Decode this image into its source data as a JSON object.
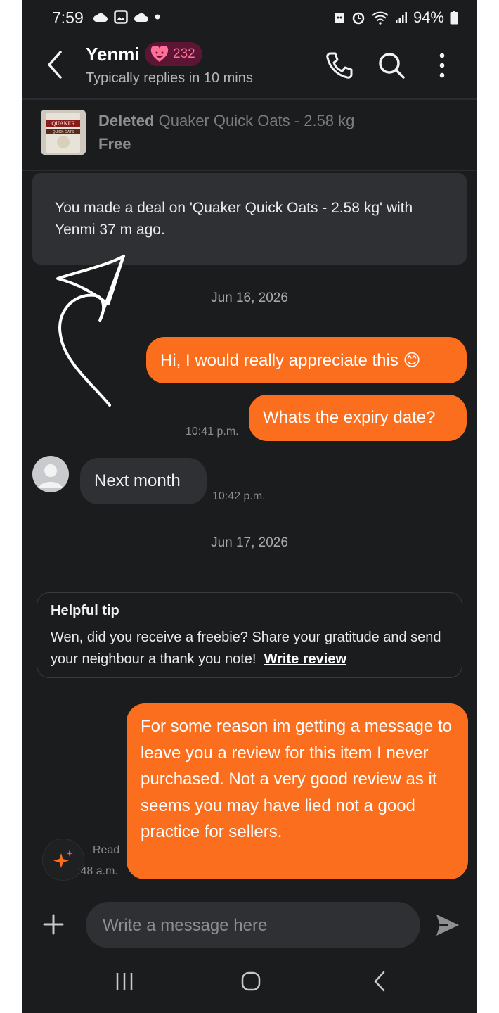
{
  "status_bar": {
    "time": "7:59",
    "battery": "94%"
  },
  "header": {
    "title": "Yenmi",
    "badge_count": "232",
    "subtitle": "Typically replies in 10 mins"
  },
  "listing": {
    "status": "Deleted",
    "name": "Quaker Quick Oats - 2.58 kg",
    "price": "Free",
    "thumb_brand": "QUAKER",
    "thumb_caption": "QUICK OATS"
  },
  "deal_notice": "You made a deal on 'Quaker Quick Oats - 2.58 kg' with Yenmi 37 m ago.",
  "messages": {
    "date1": "Jun 16, 2026",
    "msg1": "Hi, I would really appreciate this",
    "msg1_emoji": "😊",
    "msg2": "Whats the expiry date?",
    "msg2_time": "10:41 p.m.",
    "msg3": "Next month",
    "msg3_time": "10:42 p.m.",
    "date2": "Jun 17, 2026",
    "msg4": "For some reason im getting a message to leave you a review for this item I never purchased. Not a very good review as it seems you may have lied not a good practice for sellers.",
    "msg4_read": "Read",
    "msg4_time": ":48 a.m."
  },
  "tip": {
    "title": "Helpful tip",
    "text": "Wen, did you receive a freebie? Share your gratitude and send your neighbour a thank you note!",
    "link": "Write review"
  },
  "composer": {
    "placeholder": "Write a message here"
  },
  "colors": {
    "accent": "#fb6e1d",
    "background": "#1b1c1e",
    "bubble_in": "#2f3033",
    "badge_bg": "#5c1534",
    "badge_fg": "#ff6f98"
  },
  "icons": [
    "cloud-icon",
    "image-icon",
    "alarm-icon",
    "wifi-icon",
    "signal-icon",
    "battery-icon",
    "back-icon",
    "heart-face-icon",
    "phone-icon",
    "search-icon",
    "more-vertical-icon",
    "user-avatar-icon",
    "sparkle-icon",
    "plus-icon",
    "send-icon",
    "recents-nav-icon",
    "home-nav-icon",
    "back-nav-icon"
  ]
}
